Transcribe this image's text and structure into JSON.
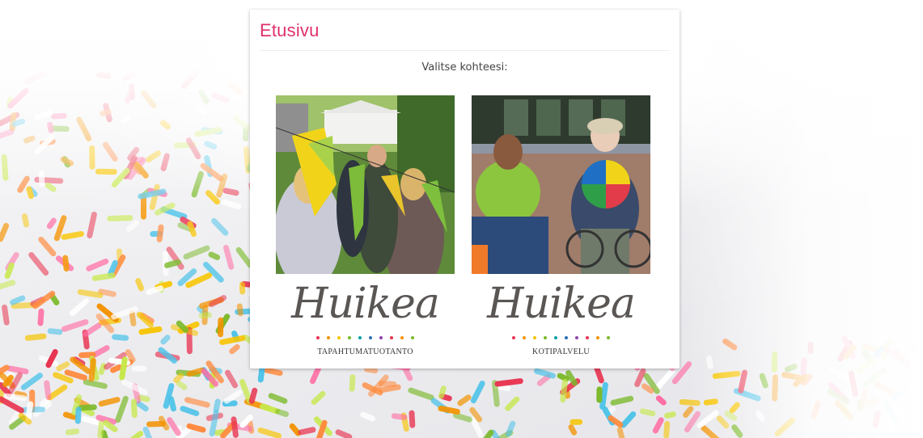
{
  "header": {
    "title": "Etusivu"
  },
  "main": {
    "prompt": "Valitse kohteesi:",
    "options": [
      {
        "brand": "Huikea",
        "caption": "TAPAHTUMATUOTANTO",
        "photo": "outdoor-event-crowd-flags"
      },
      {
        "brand": "Huikea",
        "caption": "KOTIPALVELU",
        "photo": "caregiver-with-elderly-woman"
      }
    ]
  },
  "colors": {
    "title": "#e0306a",
    "logo_text": "#5a5654",
    "dots": [
      "#e8334f",
      "#f39200",
      "#f7c400",
      "#7ab929",
      "#00a0a6",
      "#2c6fb6",
      "#8e44ad",
      "#e8334f",
      "#f39200",
      "#7ab929"
    ]
  }
}
